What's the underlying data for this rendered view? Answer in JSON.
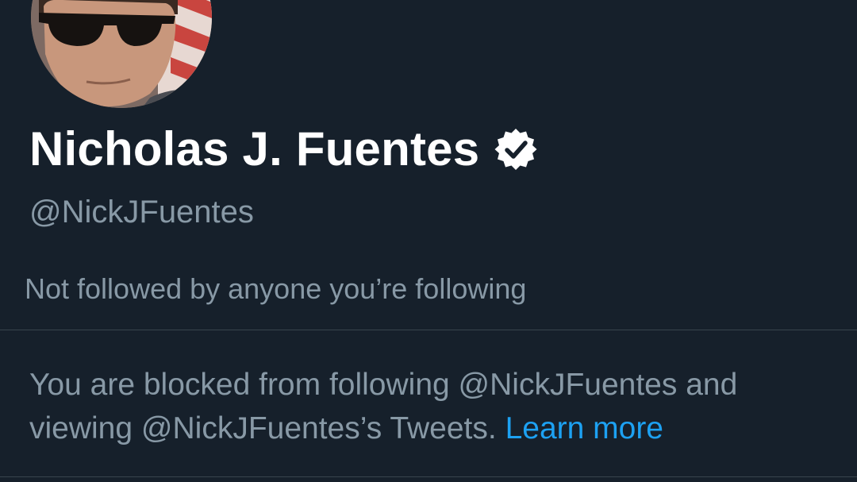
{
  "profile": {
    "display_name": "Nicholas J. Fuentes",
    "handle": "@NickJFuentes",
    "followers_you_know": "Not followed by anyone you’re following"
  },
  "block_notice": {
    "message": "You are blocked from following @NickJFuentes and viewing @NickJFuentes’s Tweets.",
    "learn_more_label": "Learn more"
  },
  "icons": {
    "verified": "verified-badge-icon",
    "avatar": "profile-avatar"
  },
  "colors": {
    "background": "#16202b",
    "primary_text": "#ffffff",
    "secondary_text": "#8899a6",
    "link": "#1da1f2",
    "divider": "#38444d"
  }
}
